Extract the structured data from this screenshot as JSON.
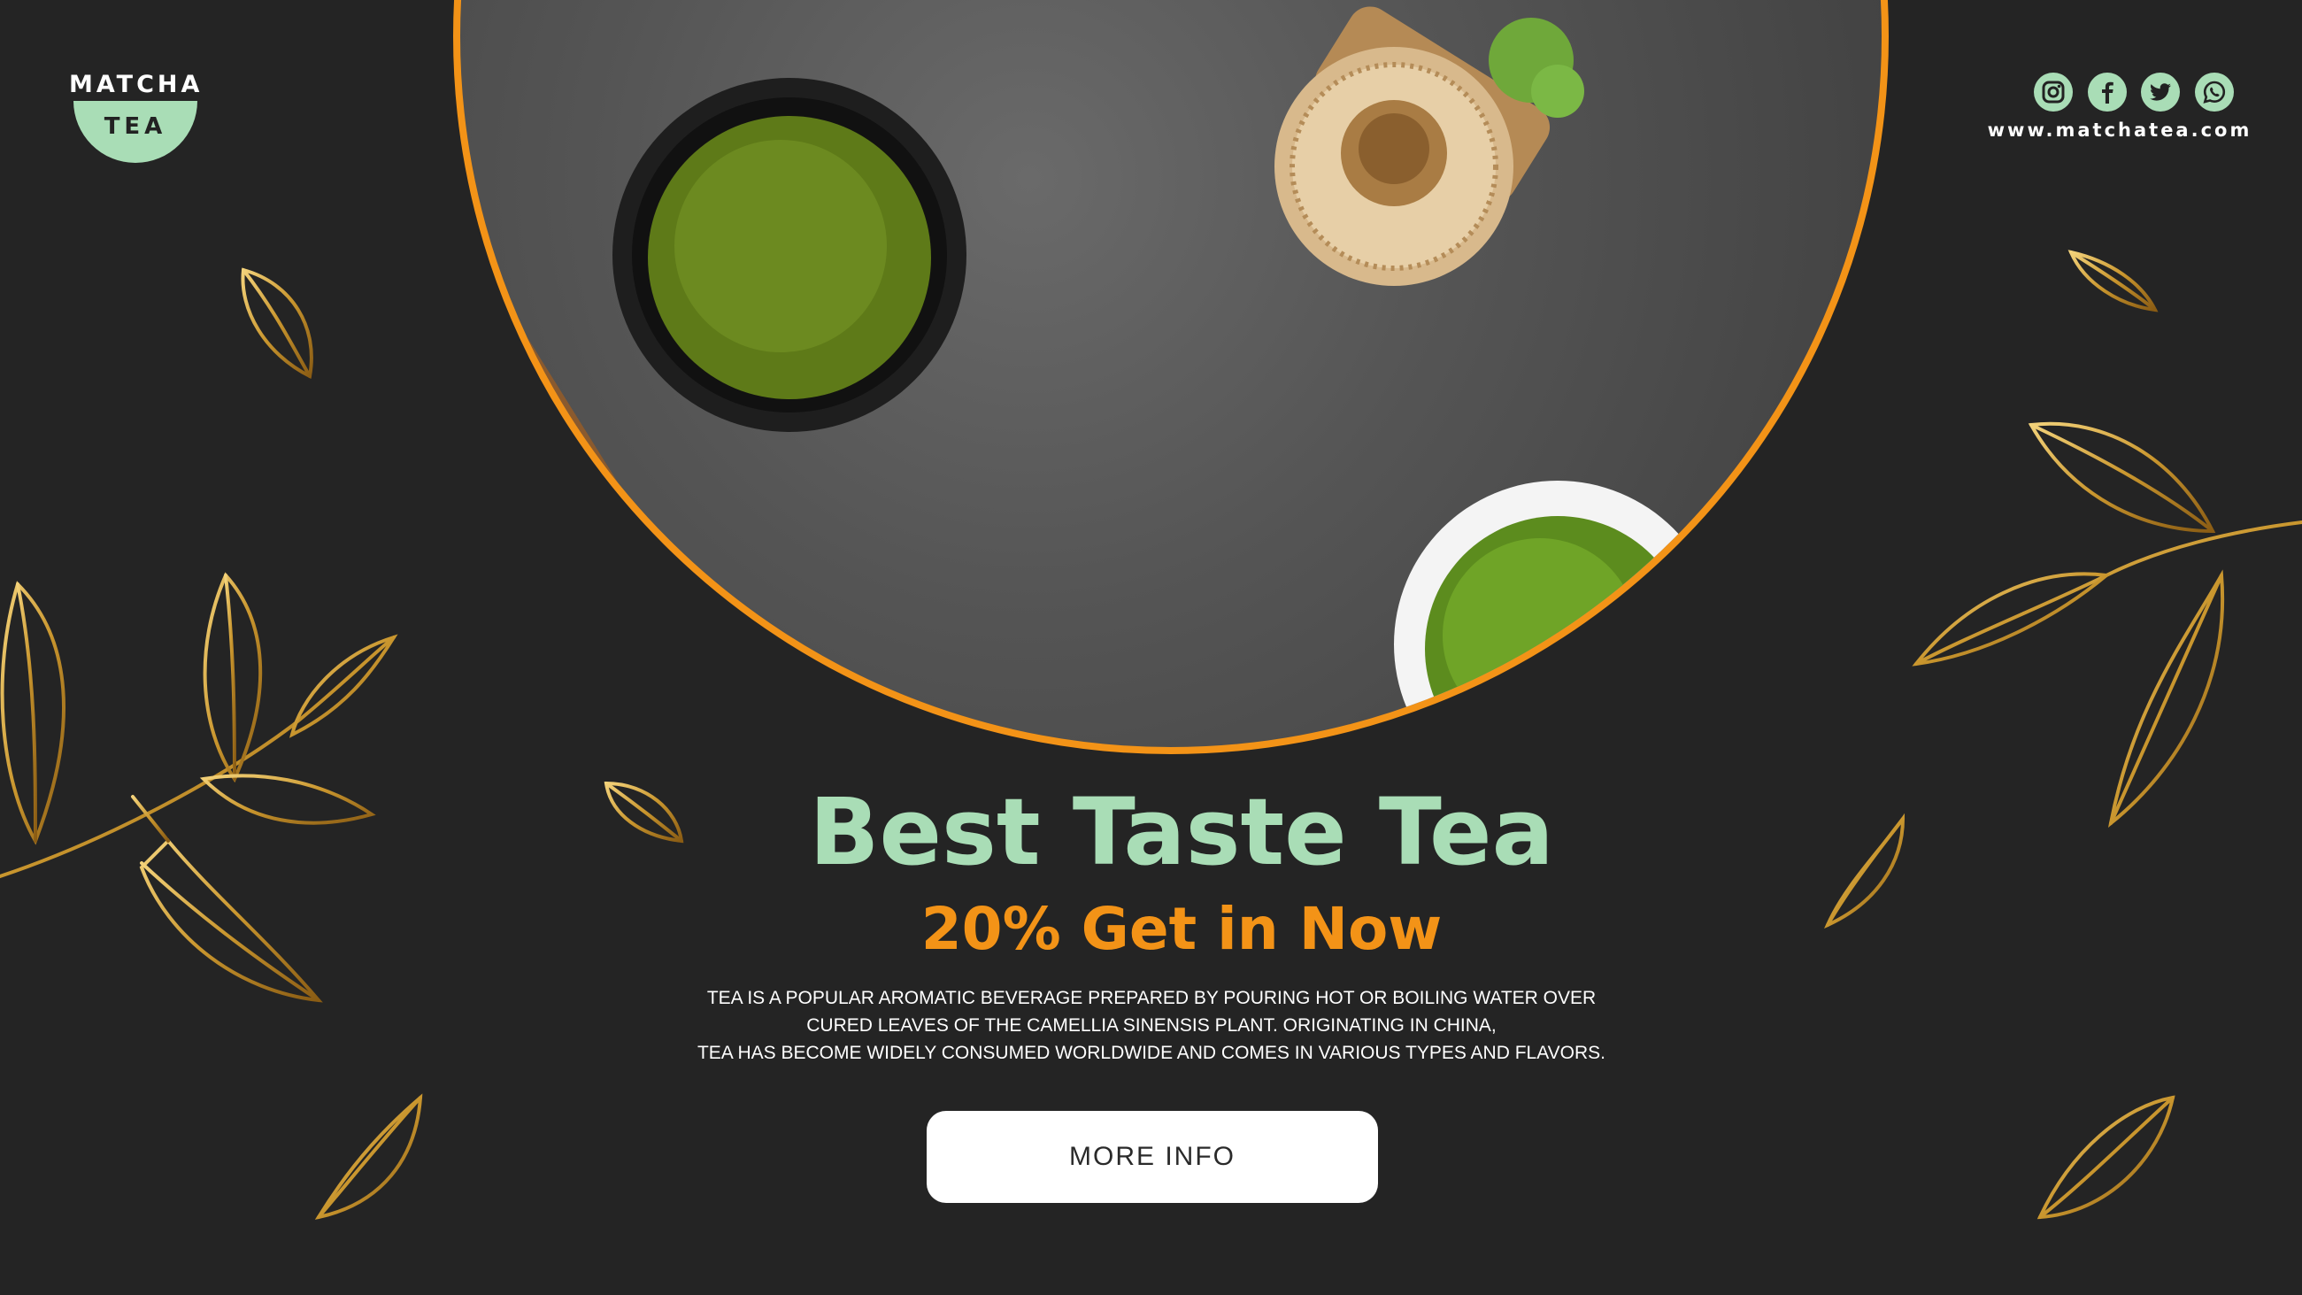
{
  "logo": {
    "title": "MATCHA",
    "badge": "TEA"
  },
  "social": {
    "icons": [
      "instagram-icon",
      "facebook-icon",
      "twitter-icon",
      "whatsapp-icon"
    ],
    "website": "www.matchatea.com"
  },
  "hero": {
    "headline": "Best Taste Tea",
    "subheadline": "20% Get in Now",
    "body_lines": [
      "TEA IS A POPULAR AROMATIC BEVERAGE PREPARED BY POURING HOT OR BOILING WATER OVER",
      "CURED LEAVES OF THE CAMELLIA SINENSIS PLANT. ORIGINATING IN CHINA,",
      "TEA HAS BECOME WIDELY CONSUMED WORLDWIDE AND COMES IN VARIOUS TYPES AND FLAVORS."
    ],
    "button_label": "MORE INFO"
  },
  "colors": {
    "background": "#242424",
    "accent_green": "#a9ddb6",
    "accent_orange": "#f39317",
    "gold": "#d4a93c"
  }
}
